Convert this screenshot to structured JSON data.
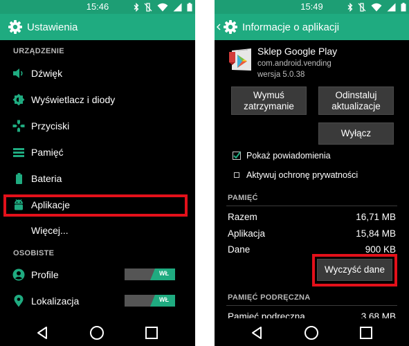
{
  "colors": {
    "accent": "#1fab80",
    "status_bar": "#1d9e74",
    "highlight": "#e3101a",
    "background": "#000000"
  },
  "left": {
    "time": "15:46",
    "title": "Ustawienia",
    "section_device": "URZĄDZENIE",
    "items": [
      {
        "label": "Dźwięk",
        "icon": "volume-icon"
      },
      {
        "label": "Wyświetlacz i diody",
        "icon": "brightness-icon"
      },
      {
        "label": "Przyciski",
        "icon": "gamepad-icon"
      },
      {
        "label": "Pamięć",
        "icon": "storage-icon"
      },
      {
        "label": "Bateria",
        "icon": "battery-icon"
      },
      {
        "label": "Aplikacje",
        "icon": "android-icon"
      },
      {
        "label": "Więcej..."
      }
    ],
    "section_personal": "OSOBISTE",
    "personal_items": [
      {
        "label": "Profile",
        "icon": "profile-icon",
        "toggle": "WŁ"
      },
      {
        "label": "Lokalizacja",
        "icon": "location-icon",
        "toggle": "WŁ"
      }
    ]
  },
  "right": {
    "time": "15:49",
    "title": "Informacje o aplikacji",
    "app_name": "Sklep Google Play",
    "package": "com.android.vending",
    "version": "wersja 5.0.38",
    "buttons": {
      "force_stop": "Wymuś zatrzymanie",
      "uninstall_updates": "Odinstaluj aktualizacje",
      "disable": "Wyłącz",
      "clear_data": "Wyczyść dane"
    },
    "show_notifications": "Pokaż powiadomienia",
    "show_notifications_checked": true,
    "privacy": "Aktywuj ochronę prywatności",
    "privacy_checked": false,
    "storage_section": "PAMIĘĆ",
    "storage": [
      {
        "label": "Razem",
        "value": "16,71 MB"
      },
      {
        "label": "Aplikacja",
        "value": "15,84 MB"
      },
      {
        "label": "Dane",
        "value": "900 KB"
      }
    ],
    "cache_section": "PAMIĘĆ PODRĘCZNA",
    "cache": {
      "label": "Pamięć podręczna",
      "value": "3,68 MB"
    }
  }
}
